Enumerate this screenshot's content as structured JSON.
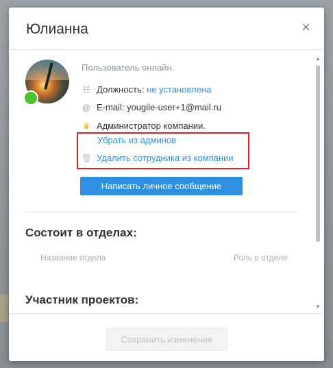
{
  "modal": {
    "title": "Юлианна",
    "close_label": "×"
  },
  "profile": {
    "status": "Пользователь онлайн.",
    "position_label": "Должность:",
    "position_value": "не установлена",
    "email_label": "E-mail:",
    "email_value": "yougile-user+1@mail.ru",
    "role": "Администратор компании."
  },
  "icons": {
    "position": "org-chart-icon",
    "email": "at-icon",
    "role": "crown-icon",
    "delete": "trash-icon",
    "close": "close-icon"
  },
  "actions": {
    "remove_admin": "Убрать из админов",
    "delete_employee": "Удалить сотрудника из компании",
    "message_button": "Написать личное сообщение"
  },
  "departments": {
    "title": "Состоит в отделах:",
    "col_name": "Название отдела",
    "col_role": "Роль в отделе"
  },
  "projects": {
    "title": "Участник проектов:"
  },
  "footer": {
    "save_button": "Сохранить изменения"
  },
  "colors": {
    "accent": "#2f8fe0",
    "online": "#4fc12e",
    "highlight": "#e01b24",
    "crown": "#f2b000"
  }
}
